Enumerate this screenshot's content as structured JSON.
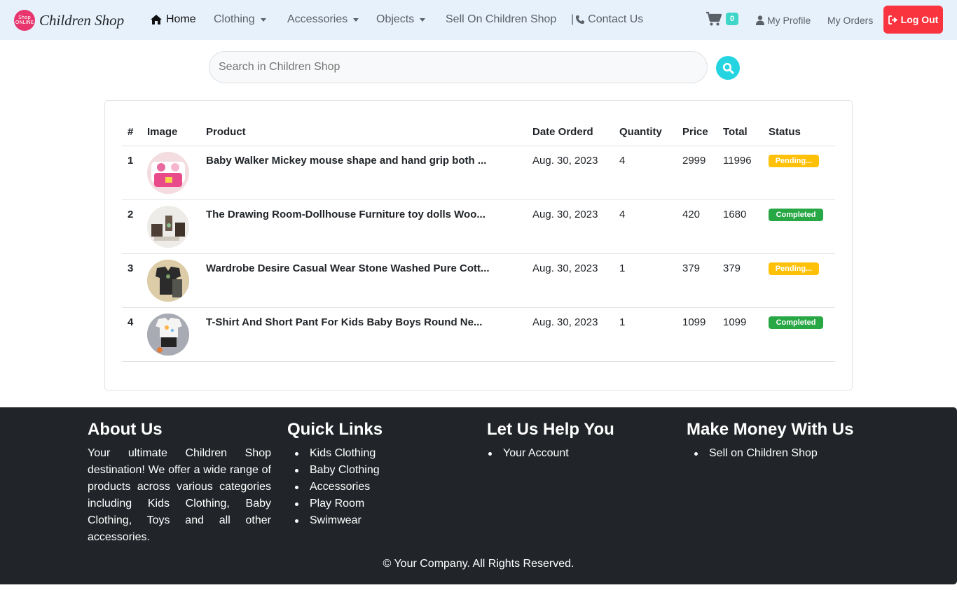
{
  "navbar": {
    "brand_logo_text": "Shop ONLINE",
    "brand_name": "Children Shop",
    "items": [
      {
        "label": "Home",
        "icon": "home-icon"
      },
      {
        "label": "Clothing",
        "dropdown": true
      },
      {
        "label": "Accessories",
        "dropdown": true
      },
      {
        "label": "Objects",
        "dropdown": true
      },
      {
        "label": "Sell On Children Shop"
      },
      {
        "label": "Contact Us",
        "prefix": "|",
        "icon": "phone-icon"
      }
    ],
    "cart_count": "0",
    "my_profile": "My Profile",
    "my_orders": "My Orders",
    "logout": "Log Out"
  },
  "search": {
    "placeholder": "Search in Children Shop"
  },
  "orders": {
    "headers": [
      "#",
      "Image",
      "Product",
      "Date Orderd",
      "Quantity",
      "Price",
      "Total",
      "Status"
    ],
    "rows": [
      {
        "num": "1",
        "product": "Baby Walker Mickey mouse shape and hand grip both ...",
        "date": "Aug. 30, 2023",
        "quantity": "4",
        "price": "2999",
        "total": "11996",
        "status": "Pending..."
      },
      {
        "num": "2",
        "product": "The Drawing Room-Dollhouse Furniture toy dolls Woo...",
        "date": "Aug. 30, 2023",
        "quantity": "4",
        "price": "420",
        "total": "1680",
        "status": "Completed"
      },
      {
        "num": "3",
        "product": "Wardrobe Desire Casual Wear Stone Washed Pure Cott...",
        "date": "Aug. 30, 2023",
        "quantity": "1",
        "price": "379",
        "total": "379",
        "status": "Pending..."
      },
      {
        "num": "4",
        "product": "T-Shirt And Short Pant For Kids Baby Boys Round Ne...",
        "date": "Aug. 30, 2023",
        "quantity": "1",
        "price": "1099",
        "total": "1099",
        "status": "Completed"
      }
    ]
  },
  "footer": {
    "about_title": "About Us",
    "about_text": "Your ultimate Children Shop destination! We offer a wide range of products across various categories including Kids Clothing, Baby Clothing, Toys and all other accessories.",
    "quick_links_title": "Quick Links",
    "quick_links": [
      "Kids Clothing",
      "Baby Clothing",
      "Accessories",
      "Play Room",
      "Swimwear"
    ],
    "help_title": "Let Us Help You",
    "help_links": [
      "Your Account"
    ],
    "money_title": "Make Money With Us",
    "money_links": [
      "Sell on Children Shop"
    ],
    "copyright": "© Your Company. All Rights Reserved."
  },
  "colors": {
    "navbar_bg": "#e7f1fb",
    "logout_bg": "#f9343e",
    "search_btn": "#24d4e0",
    "cart_badge": "#3dd6c8",
    "pending": "#ffc107",
    "completed": "#28a745",
    "footer_bg": "#212529"
  }
}
